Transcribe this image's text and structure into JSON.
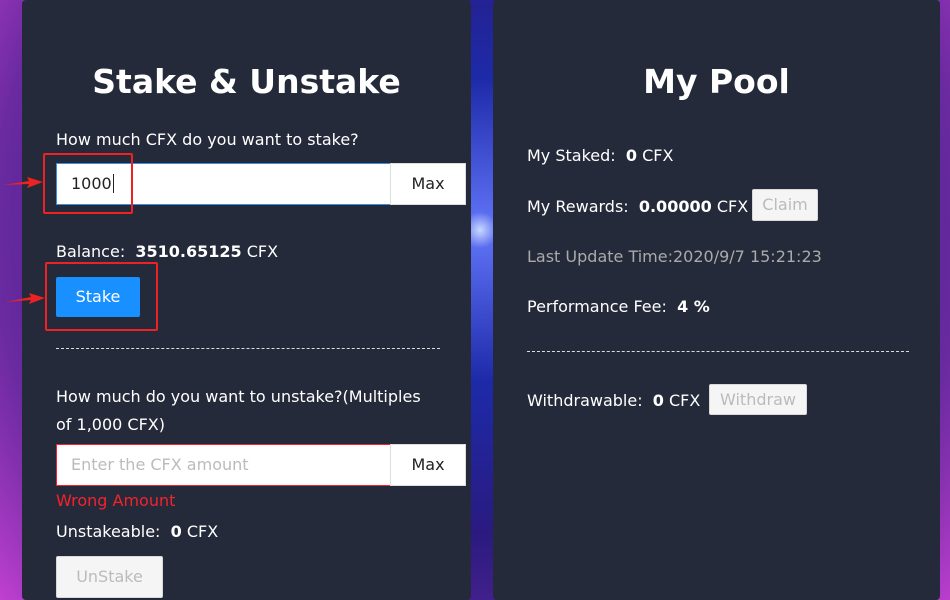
{
  "stake": {
    "title": "Stake & Unstake",
    "stake_question": "How much CFX do you want to stake?",
    "stake_value": "1000",
    "max_label": "Max",
    "balance_label": "Balance:",
    "balance_value": "3510.65125",
    "unit": "CFX",
    "stake_button": "Stake",
    "unstake_question_line1": "How much do you want to unstake?(Multiples",
    "unstake_question_line2": "of 1,000 CFX)",
    "unstake_placeholder": "Enter the CFX amount",
    "error": "Wrong Amount",
    "unstakeable_label": "Unstakeable:",
    "unstakeable_value": "0",
    "unstake_button": "UnStake"
  },
  "pool": {
    "title": "My Pool",
    "staked_label": "My Staked:",
    "staked_value": "0",
    "rewards_label": "My Rewards:",
    "rewards_value": "0.00000",
    "claim_button": "Claim",
    "last_update": "Last Update Time:2020/9/7 15:21:23",
    "fee_label": "Performance Fee:",
    "fee_value": "4 %",
    "withdrawable_label": "Withdrawable:",
    "withdrawable_value": "0",
    "withdraw_button": "Withdraw",
    "unit": "CFX"
  },
  "colors": {
    "primary": "#1890ff",
    "error": "#f5222d",
    "panel": "#252a3a",
    "annotation": "#ee2222"
  }
}
